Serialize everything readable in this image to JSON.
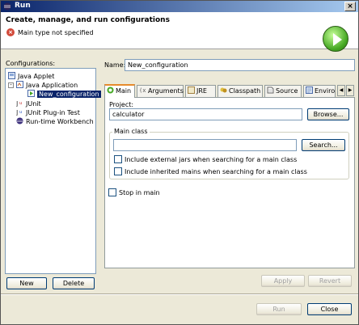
{
  "window": {
    "title": "Run",
    "close_glyph": "×"
  },
  "banner": {
    "title": "Create, manage, and run configurations",
    "message": "Main type not specified",
    "error_glyph": "×"
  },
  "left": {
    "label": "Configurations:",
    "tree": [
      {
        "label": "Java Applet",
        "icon": "java-applet-icon"
      },
      {
        "label": "Java Application",
        "icon": "java-application-icon",
        "expanded": true
      },
      {
        "label": "New_configuration",
        "icon": "launch-config-icon",
        "selected": true
      },
      {
        "label": "JUnit",
        "icon": "junit-icon"
      },
      {
        "label": "JUnit Plug-in Test",
        "icon": "junit-plugin-icon"
      },
      {
        "label": "Run-time Workbench",
        "icon": "workbench-icon"
      }
    ],
    "expander_glyph": "-",
    "new_label": "New",
    "delete_label": "Delete"
  },
  "right": {
    "name_label": "Name:",
    "name_value": "New_configuration",
    "tabs": [
      {
        "label": "Main",
        "icon": "main-tab-icon",
        "active": true
      },
      {
        "label": "Arguments",
        "icon": "arguments-icon"
      },
      {
        "label": "JRE",
        "icon": "jre-icon"
      },
      {
        "label": "Classpath",
        "icon": "classpath-icon"
      },
      {
        "label": "Source",
        "icon": "source-icon"
      },
      {
        "label": "Enviror",
        "icon": "environment-icon"
      }
    ],
    "tab_left_arrow": "◀",
    "tab_right_arrow": "▶",
    "project_label": "Project:",
    "project_value": "calculator",
    "browse_label": "Browse...",
    "main_class_group": "Main class",
    "main_class_value": "",
    "search_label": "Search...",
    "include_external": "Include external jars when searching for a main class",
    "include_inherited": "Include inherited mains when searching for a main class",
    "stop_in_main": "Stop in main",
    "apply_label": "Apply",
    "revert_label": "Revert"
  },
  "footer": {
    "run_label": "Run",
    "close_label": "Close"
  },
  "colors": {
    "accent_orange": "#e68b2c",
    "selection": "#0a246a",
    "error_red": "#d24a3a",
    "run_green": "#45a823"
  }
}
